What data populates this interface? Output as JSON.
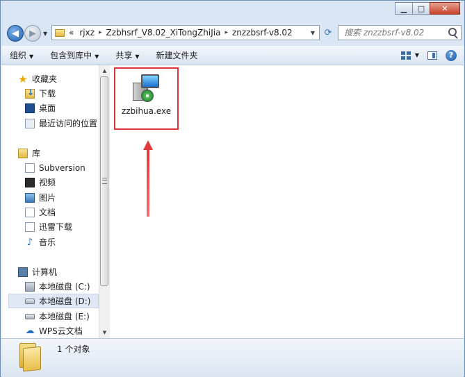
{
  "window": {
    "minimize_glyph": "▁",
    "maximize_glyph": "□",
    "close_glyph": "✕"
  },
  "address_bar": {
    "back_glyph": "◀",
    "forward_glyph": "▶",
    "overflow_glyph": "«",
    "separator_glyph": "▸",
    "dropdown_glyph": "▼",
    "refresh_glyph": "⟳",
    "crumbs": [
      "rjxz",
      "Zzbhsrf_V8.02_XiTongZhiJia",
      "znzzbsrf-v8.02"
    ]
  },
  "search": {
    "placeholder": "搜索 znzzbsrf-v8.02"
  },
  "toolbar": {
    "arrow_glyph": "▼",
    "organize": "组织",
    "include_in_library": "包含到库中",
    "share": "共享",
    "new_folder": "新建文件夹",
    "help_glyph": "?"
  },
  "nav": {
    "favorites": "收藏夹",
    "downloads": "下载",
    "desktop": "桌面",
    "recent": "最近访问的位置",
    "libraries": "库",
    "subversion": "Subversion",
    "videos": "视频",
    "pictures": "图片",
    "documents": "文档",
    "thunder": "迅雷下载",
    "music": "音乐",
    "computer": "计算机",
    "drive_c": "本地磁盘 (C:)",
    "drive_d": "本地磁盘 (D:)",
    "drive_e": "本地磁盘 (E:)",
    "wps_cloud": "WPS云文档",
    "star_glyph": "★",
    "music_glyph": "♪",
    "cloud_glyph": "☁"
  },
  "scrollbar": {
    "up_glyph": "▲",
    "down_glyph": "▼"
  },
  "content": {
    "file_name": "zzbihua.exe"
  },
  "status": {
    "count_text": "1 个对象"
  },
  "colors": {
    "highlight_box": "#e0303a",
    "arrow": "#e23a3a"
  }
}
